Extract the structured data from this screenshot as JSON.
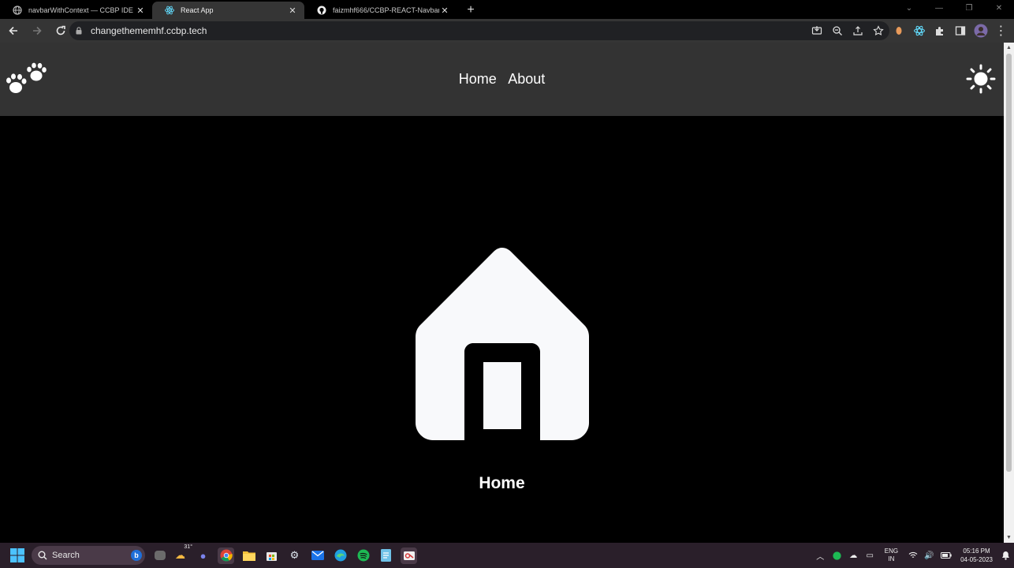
{
  "browser": {
    "tabs": [
      {
        "title": "navbarWithContext — CCBP IDE",
        "active": false
      },
      {
        "title": "React App",
        "active": true
      },
      {
        "title": "faizmhf666/CCBP-REACT-Navbar-with-",
        "active": false
      }
    ],
    "url": "changethememhf.ccbp.tech"
  },
  "page": {
    "nav_links": [
      {
        "label": "Home"
      },
      {
        "label": "About"
      }
    ],
    "heading": "Home",
    "colors": {
      "navbar_bg": "#333333",
      "page_bg": "#000000",
      "text": "#ffffff"
    }
  },
  "taskbar": {
    "search_placeholder": "Search",
    "weather_temp": "31°",
    "lang_line1": "ENG",
    "lang_line2": "IN",
    "time": "05:16 PM",
    "date": "04-05-2023"
  }
}
